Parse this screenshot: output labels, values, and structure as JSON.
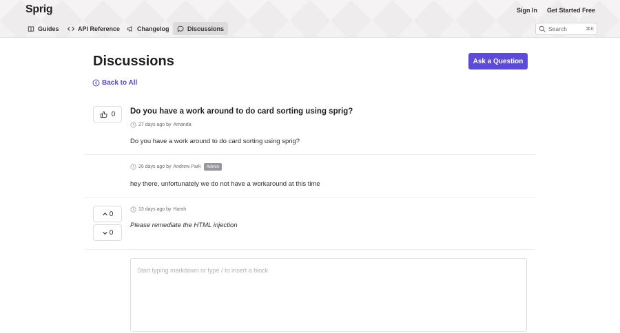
{
  "header": {
    "logo": "Sprig",
    "sign_in": "Sign In",
    "get_started": "Get Started Free",
    "nav": [
      {
        "label": "Guides",
        "icon": "book-icon"
      },
      {
        "label": "API Reference",
        "icon": "code-icon"
      },
      {
        "label": "Changelog",
        "icon": "megaphone-icon"
      },
      {
        "label": "Discussions",
        "icon": "chat-bubble-icon",
        "active": true
      }
    ],
    "search": {
      "placeholder": "Search",
      "shortcut": "⌘K"
    }
  },
  "main": {
    "title": "Discussions",
    "ask_button": "Ask a Question",
    "back_link": "Back to All",
    "question": {
      "votes": "0",
      "title": "Do you have a work around to do card sorting using sprig?",
      "time": "27 days ago by",
      "author": "Amanda",
      "body": "Do you have a work around to do card sorting using sprig?"
    },
    "replies": [
      {
        "time": "26 days ago by",
        "author": "Andrew Park",
        "badge": "Admin",
        "body": "hey there, unfortunately we do not have a workaround at this time"
      },
      {
        "time": "13 days ago by",
        "author": "Harsh",
        "upvotes": "0",
        "downvotes": "0",
        "body": "Please remediate the HTML injection"
      }
    ],
    "editor_placeholder": "Start typing markdown or type / to insert a block"
  },
  "colors": {
    "accent": "#5b4bd6",
    "link": "#5547c7",
    "header_bg": "#efeced"
  }
}
